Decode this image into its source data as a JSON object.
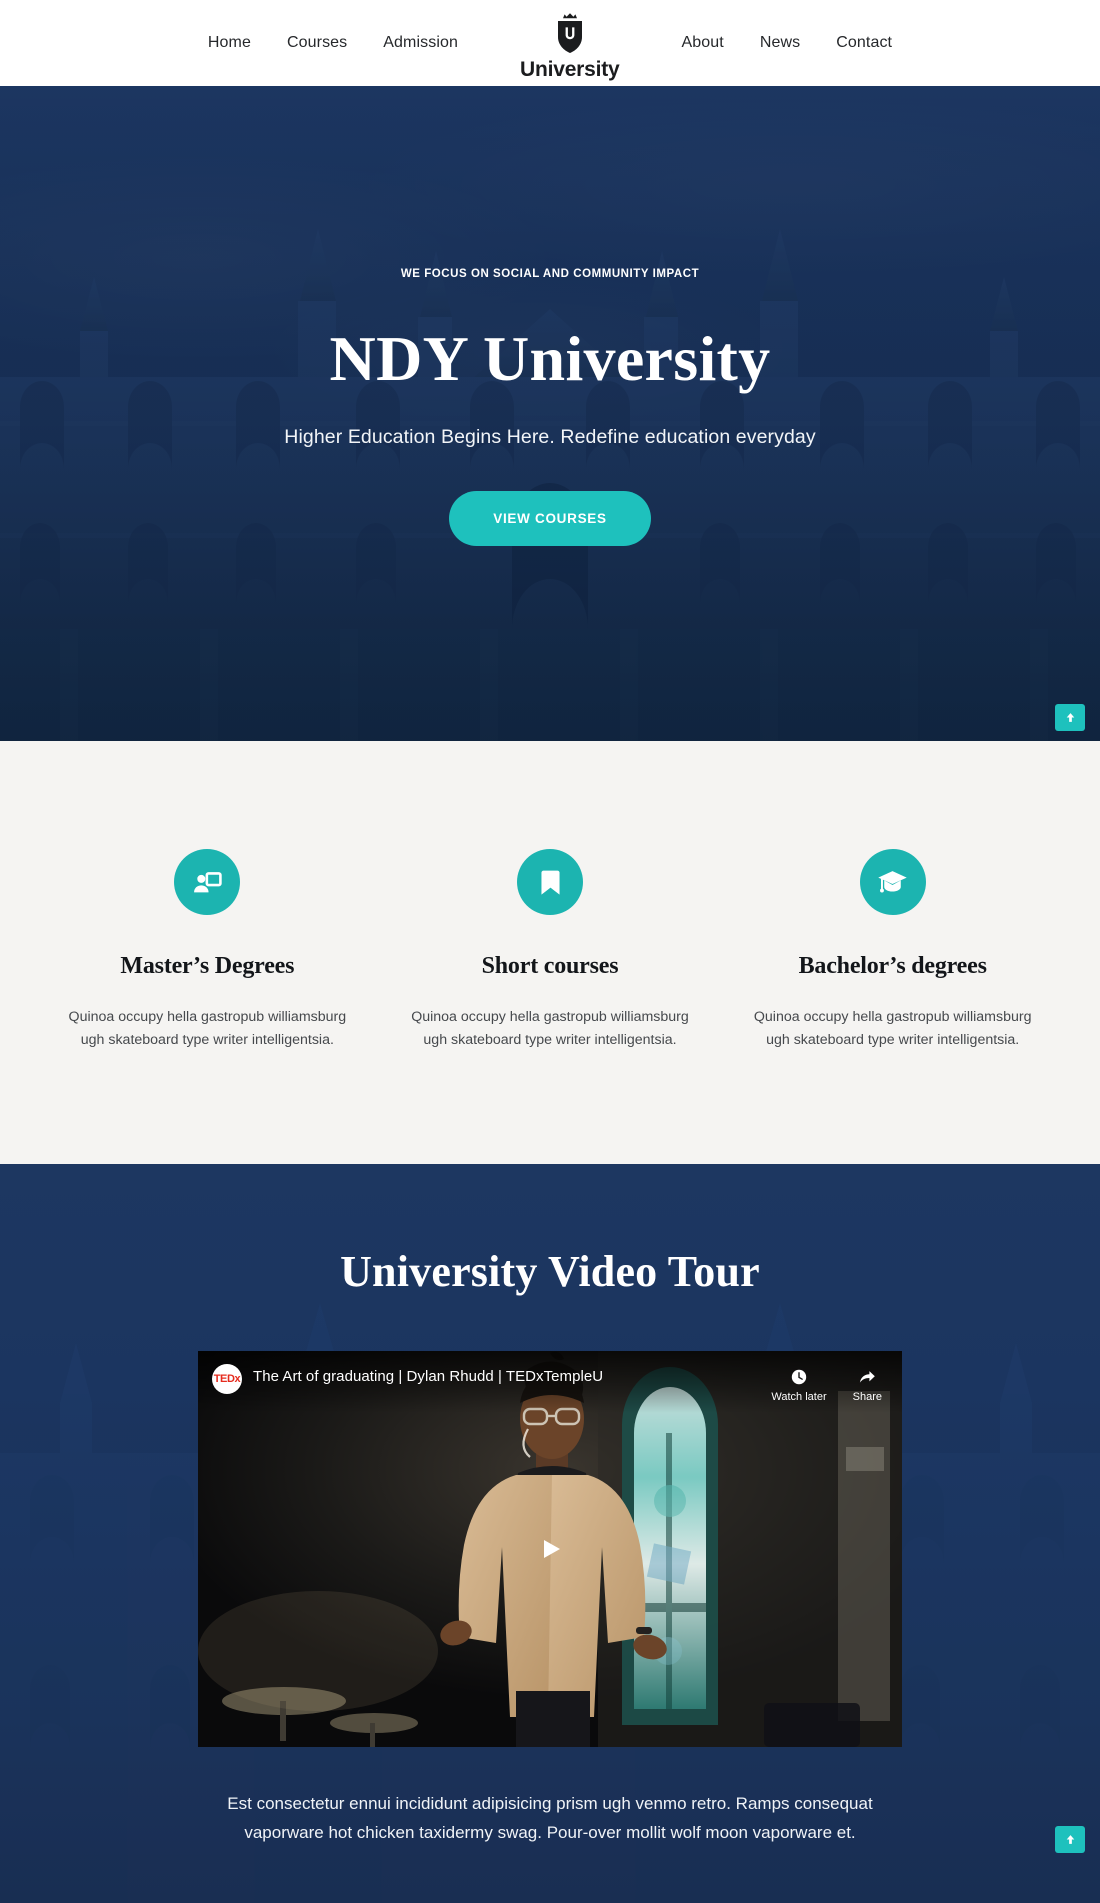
{
  "nav": {
    "left_links": [
      {
        "label": "Home"
      },
      {
        "label": "Courses"
      },
      {
        "label": "Admission"
      }
    ],
    "right_links": [
      {
        "label": "About"
      },
      {
        "label": "News"
      },
      {
        "label": "Contact"
      }
    ],
    "brand": {
      "name": "University",
      "logo_icon": "shield-crown-u-icon"
    }
  },
  "hero": {
    "eyebrow": "WE FOCUS ON SOCIAL AND COMMUNITY IMPACT",
    "title": "NDY University",
    "subtitle": "Higher Education Begins Here. Redefine education everyday",
    "cta_label": "VIEW COURSES",
    "cta_color": "#1ec1bd",
    "overlay_color": "#1b3560"
  },
  "features": {
    "background": "#f5f4f2",
    "icon_color": "#1cb4b0",
    "items": [
      {
        "icon": "presentation-person-icon",
        "title": "Master’s Degrees",
        "text": "Quinoa occupy hella gastropub williamsburg ugh skateboard type writer intelligentsia."
      },
      {
        "icon": "bookmark-icon",
        "title": "Short courses",
        "text": "Quinoa occupy hella gastropub williamsburg ugh skateboard type writer intelligentsia."
      },
      {
        "icon": "graduation-cap-icon",
        "title": "Bachelor’s degrees",
        "text": "Quinoa occupy hella gastropub williamsburg ugh skateboard type writer intelligentsia."
      }
    ]
  },
  "video_section": {
    "title": "University Video Tour",
    "player": {
      "channel_badge": "TEDx",
      "channel_badge_sup": "x",
      "title": "The Art of graduating | Dylan Rhudd | TEDxTempleU",
      "watch_later_label": "Watch later",
      "share_label": "Share",
      "play_icon": "play-icon"
    },
    "caption": "Est consectetur ennui incididunt adipisicing prism ugh venmo retro. Ramps consequat vaporware hot chicken taxidermy swag. Pour-over mollit wolf moon vaporware et."
  },
  "scroll_top": {
    "icon": "arrow-up-icon",
    "color": "#1ec1bd"
  }
}
